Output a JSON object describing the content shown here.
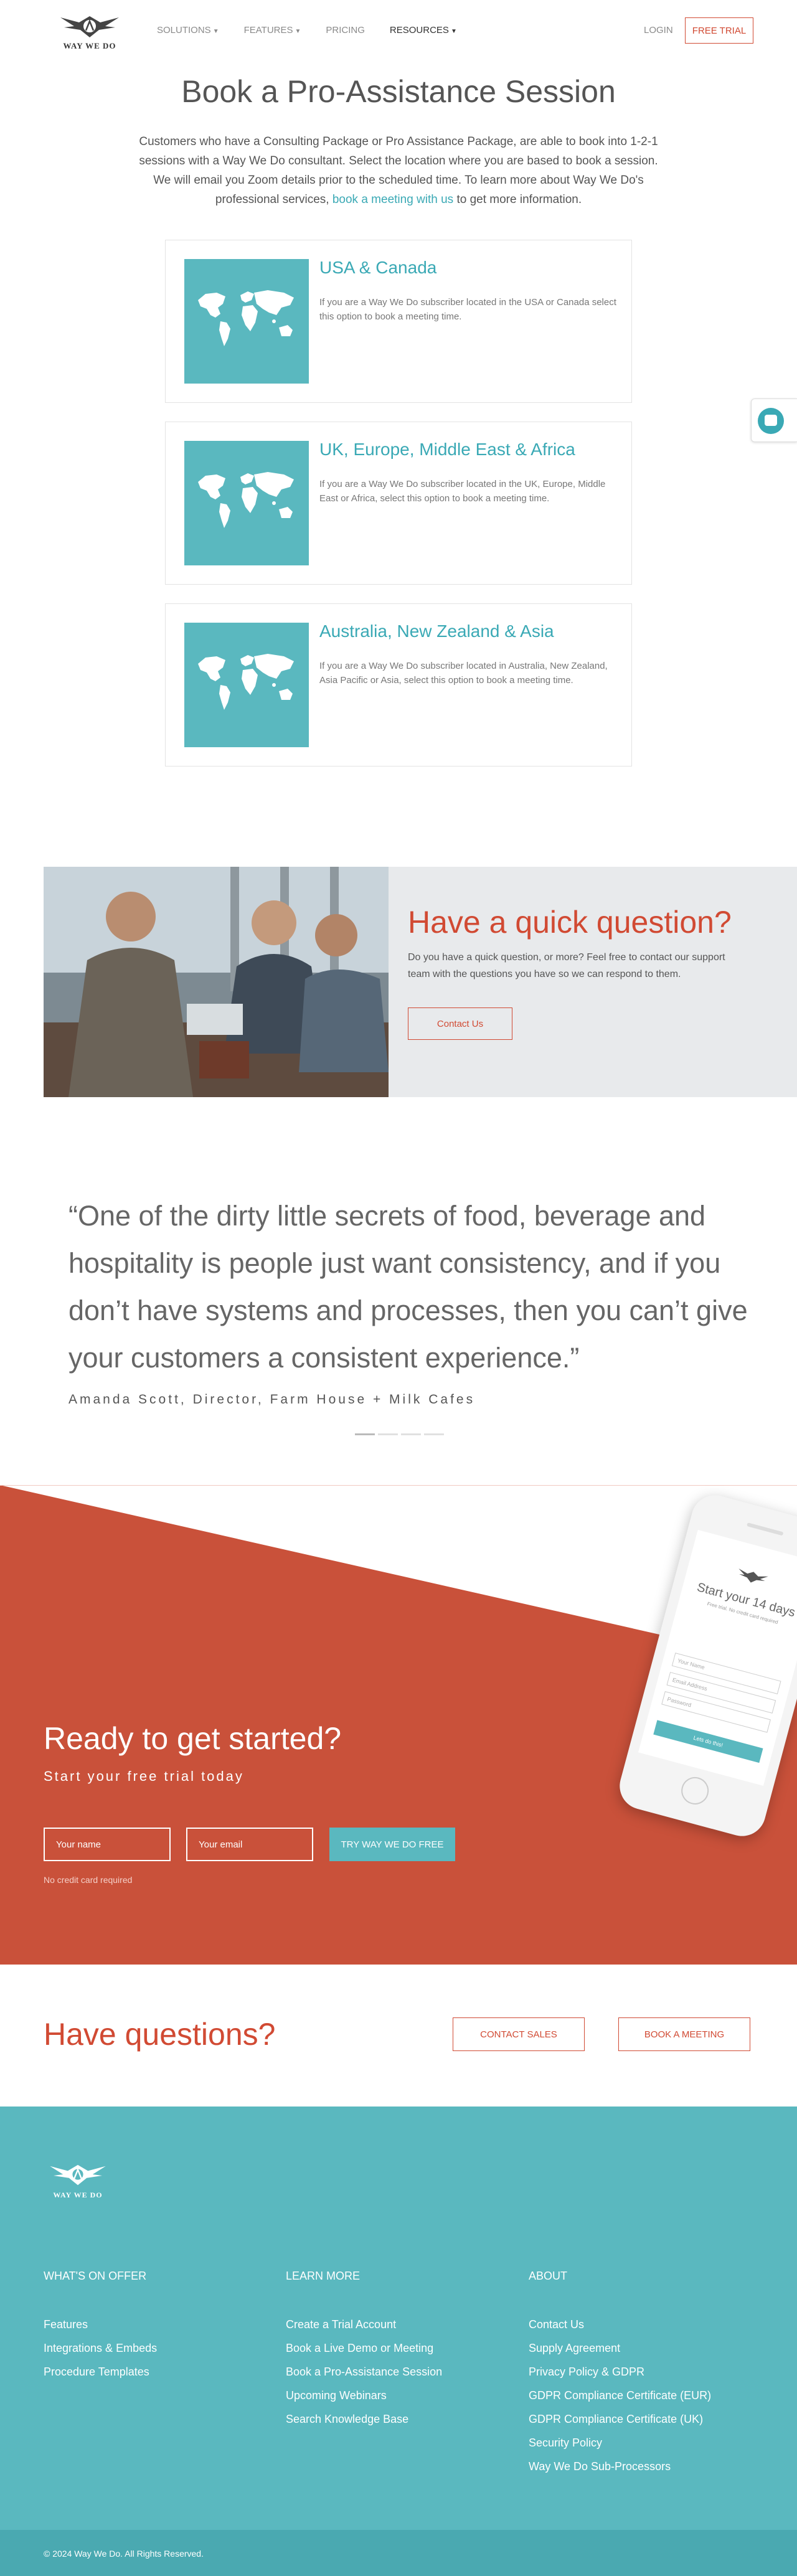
{
  "nav": {
    "brand": "WAY WE DO",
    "items": [
      {
        "label": "SOLUTIONS",
        "caret": true
      },
      {
        "label": "FEATURES",
        "caret": true
      },
      {
        "label": "PRICING",
        "caret": false
      },
      {
        "label": "RESOURCES",
        "caret": true
      }
    ],
    "login": "LOGIN",
    "free_trial": "FREE TRIAL"
  },
  "hero": {
    "title": "Book a Pro-Assistance Session",
    "text_before": "Customers who have a Consulting Package or Pro Assistance Package, are able to book into 1-2-1 sessions with a Way We Do consultant. Select the location where you are based to book a session. We will email you Zoom details prior to the scheduled time. To learn more about Way We Do's professional services, ",
    "link": "book a meeting with us",
    "text_after": " to get more information."
  },
  "cards": [
    {
      "title": "USA & Canada",
      "text": "If you are a Way We Do subscriber located in the USA or Canada select this option to book a meeting time."
    },
    {
      "title": "UK, Europe, Middle East & Africa",
      "text": "If you are a Way We Do subscriber located in the UK, Europe, Middle East or Africa, select this option to book a meeting time."
    },
    {
      "title": "Australia, New Zealand & Asia",
      "text": "If you are a Way We Do subscriber located in Australia, New Zealand, Asia Pacific or Asia, select this option to book a meeting time."
    }
  ],
  "quick_question": {
    "title": "Have a quick question?",
    "text": "Do you have a quick question, or more? Feel free to contact our support team with the questions you have so we can respond to them.",
    "button": "Contact Us"
  },
  "testimonial": {
    "quote": "“One of the dirty little secrets of food, beverage and hospitality is people just want consistency, and if you don’t have systems and processes, then you can’t give your customers a consistent experience.”",
    "author": "Amanda Scott, Director, Farm House + Milk Cafes"
  },
  "ready": {
    "title": "Ready to get started?",
    "subtitle": "Start your free trial today",
    "name_placeholder": "Your name",
    "email_placeholder": "Your email",
    "button": "TRY WAY WE DO FREE",
    "note": "No credit card required",
    "phone": {
      "title": "Start your 14 days",
      "subtitle": "Free trial. No credit card required",
      "fields": [
        "Your Name",
        "Email Address",
        "Password"
      ],
      "button": "Lets do this!"
    }
  },
  "have_questions": {
    "title": "Have questions?",
    "contact_sales": "CONTACT SALES",
    "book_meeting": "BOOK A MEETING"
  },
  "footer": {
    "brand": "WAY WE DO",
    "columns": [
      {
        "heading": "WHAT'S ON OFFER",
        "links": [
          "Features",
          "Integrations & Embeds",
          "Procedure Templates"
        ]
      },
      {
        "heading": "LEARN MORE",
        "links": [
          "Create a Trial Account",
          "Book a Live Demo or Meeting",
          "Book a Pro-Assistance Session",
          "Upcoming Webinars",
          "Search Knowledge Base"
        ]
      },
      {
        "heading": "ABOUT",
        "links": [
          "Contact Us",
          "Supply Agreement",
          "Privacy Policy & GDPR",
          "GDPR Compliance Certificate (EUR)",
          "GDPR Compliance Certificate (UK)",
          "Security Policy",
          "Way We Do Sub-Processors"
        ]
      }
    ],
    "copyright": "© 2024 Way We Do. All Rights Reserved."
  },
  "colors": {
    "accent_teal": "#5ab8bf",
    "accent_red": "#d14a33"
  }
}
